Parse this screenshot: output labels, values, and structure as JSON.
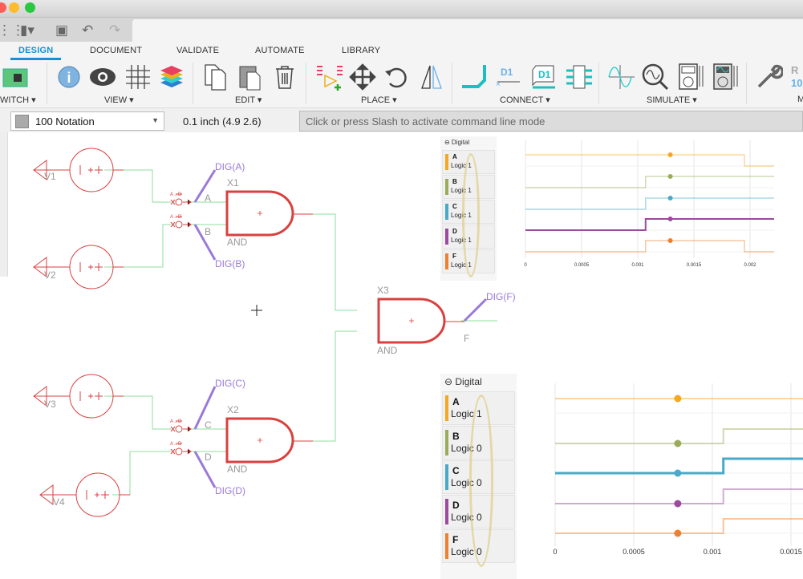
{
  "window": {
    "controls": [
      "close",
      "minimize",
      "zoom"
    ]
  },
  "quickbar": {
    "icons": [
      "grid-icon",
      "file-icon",
      "save-icon",
      "undo-icon",
      "redo-icon"
    ]
  },
  "ribbon": {
    "tabs": [
      "DESIGN",
      "DOCUMENT",
      "VALIDATE",
      "AUTOMATE",
      "LIBRARY"
    ],
    "groups": [
      "WITCH",
      "VIEW",
      "EDIT",
      "PLACE",
      "CONNECT",
      "SIMULATE",
      "M"
    ]
  },
  "cmdbar": {
    "notation": "100 Notation",
    "coordinate": "0.1 inch (4.9 2.6)",
    "command_placeholder": "Click or press Slash to activate command line mode"
  },
  "schematic": {
    "sources": [
      "V1",
      "V2",
      "V3",
      "V4"
    ],
    "gates": [
      {
        "name": "X1",
        "type": "AND",
        "inputs": [
          "A",
          "B"
        ]
      },
      {
        "name": "X2",
        "type": "AND",
        "inputs": [
          "C",
          "D"
        ]
      },
      {
        "name": "X3",
        "type": "AND",
        "inputs": [],
        "output": "F"
      }
    ],
    "probes": [
      "DIG(A)",
      "DIG(B)",
      "DIG(C)",
      "DIG(D)",
      "DIG(F)"
    ],
    "converter_label": "A→D"
  },
  "colors": {
    "A": "#f5a623",
    "B": "#9aac5a",
    "C": "#4aa8c8",
    "D": "#9b4aa0",
    "F": "#f07f2e",
    "wire": "#8fdc9c",
    "part": "#d9403f",
    "probe": "#9a7ad8"
  },
  "chart_data": [
    {
      "type": "line",
      "title": "Digital",
      "xlim": [
        0,
        0.0022
      ],
      "xticks": [
        "0",
        "0.0005",
        "0.001",
        "0.0015",
        "0.002"
      ],
      "cursor": 0.00129,
      "series": [
        {
          "name": "A",
          "value": "Logic 1",
          "steps": [
            [
              0,
              1
            ],
            [
              0.00195,
              0
            ]
          ]
        },
        {
          "name": "B",
          "value": "Logic 1",
          "steps": [
            [
              0,
              0
            ],
            [
              0.00107,
              1
            ]
          ]
        },
        {
          "name": "C",
          "value": "Logic 1",
          "steps": [
            [
              0,
              0
            ],
            [
              0.00107,
              1
            ]
          ]
        },
        {
          "name": "D",
          "value": "Logic 1",
          "steps": [
            [
              0,
              0
            ],
            [
              0.00107,
              1
            ]
          ]
        },
        {
          "name": "F",
          "value": "Logic 1",
          "steps": [
            [
              0,
              0
            ],
            [
              0.00107,
              1
            ],
            [
              0.00195,
              0
            ]
          ]
        }
      ]
    },
    {
      "type": "line",
      "title": "Digital",
      "xlim": [
        0,
        0.00158
      ],
      "xticks": [
        "0",
        "0.0005",
        "0.001",
        "0.0015"
      ],
      "cursor": 0.00078,
      "series": [
        {
          "name": "A",
          "value": "Logic 1",
          "steps": [
            [
              0,
              1
            ]
          ]
        },
        {
          "name": "B",
          "value": "Logic 0",
          "steps": [
            [
              0,
              0
            ],
            [
              0.00107,
              1
            ]
          ]
        },
        {
          "name": "C",
          "value": "Logic 0",
          "steps": [
            [
              0,
              0
            ],
            [
              0.00107,
              1
            ]
          ]
        },
        {
          "name": "D",
          "value": "Logic 0",
          "steps": [
            [
              0,
              0
            ],
            [
              0.00107,
              1
            ]
          ]
        },
        {
          "name": "F",
          "value": "Logic 0",
          "steps": [
            [
              0,
              0
            ],
            [
              0.00107,
              1
            ]
          ]
        }
      ]
    }
  ]
}
